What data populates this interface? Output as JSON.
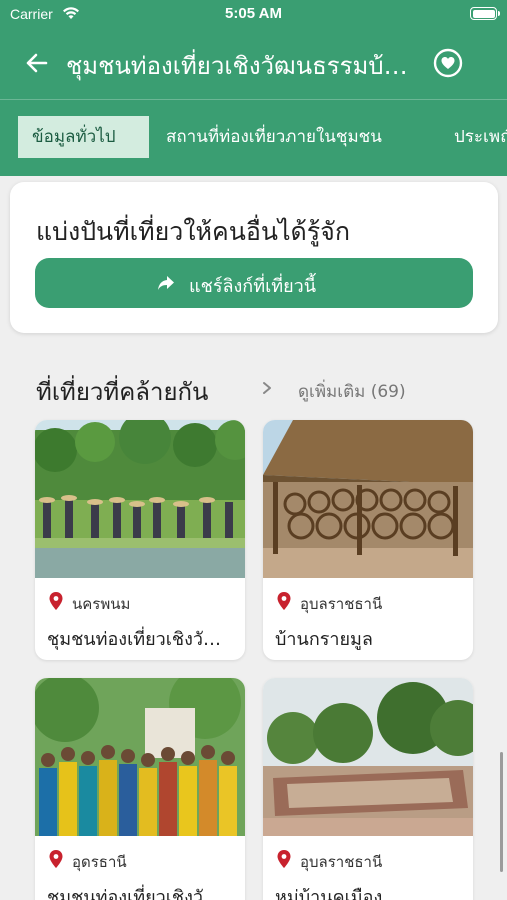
{
  "status_bar": {
    "carrier": "Carrier",
    "time": "5:05 AM"
  },
  "header": {
    "title": "ชุมชนท่องเที่ยวเชิงวัฒนธรรมบ้านนาหว้า"
  },
  "tabs": [
    {
      "label": "ข้อมูลทั่วไป",
      "active": true
    },
    {
      "label": "สถานที่ท่องเที่ยวภายในชุมชน",
      "active": false
    },
    {
      "label": "ประเพณี",
      "active": false
    }
  ],
  "share": {
    "title": "แบ่งปันที่เที่ยวให้คนอื่นได้รู้จัก",
    "button_label": "แชร์ลิงก์ที่เที่ยวนี้"
  },
  "similar": {
    "title": "ที่เที่ยวที่คล้ายกัน",
    "more_label": "ดูเพิ่มเติม (69)"
  },
  "cards": [
    {
      "province": "นครพนม",
      "name": "ชุมชนท่องเที่ยวเชิงวัฒนธรรม"
    },
    {
      "province": "อุบลราชธานี",
      "name": "บ้านกรายมูล"
    },
    {
      "province": "อุดรธานี",
      "name": "ชุมชนท่องเที่ยวเชิงวัฒนธรรม"
    },
    {
      "province": "อุบลราชธานี",
      "name": "หมู่บ้านคเมือง"
    }
  ],
  "colors": {
    "primary": "#3a9e72",
    "active_tab_bg": "#d3ecdf",
    "pin": "#c8222e",
    "background": "#efefef"
  },
  "icons": [
    "back-arrow-icon",
    "heart-icon",
    "share-icon",
    "chevron-right-icon",
    "location-pin-icon",
    "wifi-icon",
    "battery-icon"
  ]
}
